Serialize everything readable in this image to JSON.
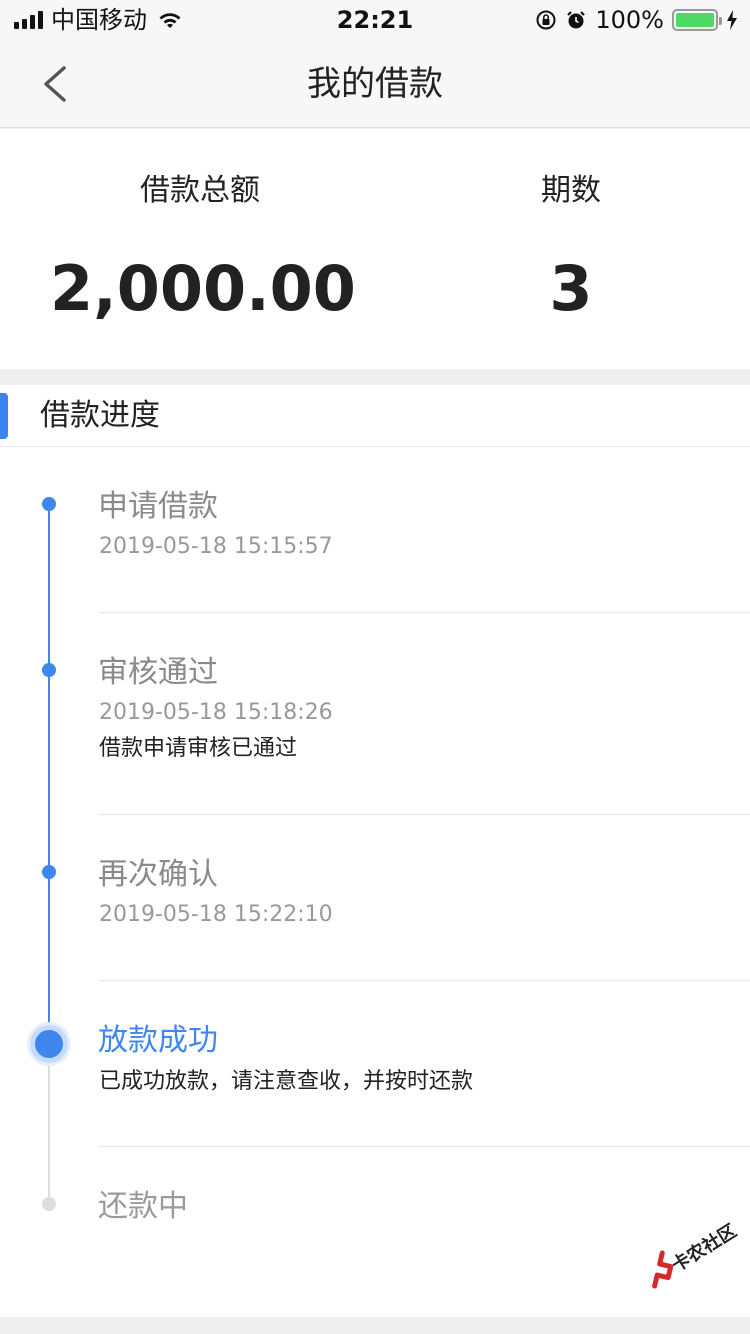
{
  "status_bar": {
    "carrier": "中国移动",
    "time": "22:21",
    "battery": "100%",
    "battery_level": 1.0,
    "battery_color": "#4cd964"
  },
  "nav": {
    "back_icon": "chevron-left-icon",
    "title": "我的借款"
  },
  "summary": {
    "total_label": "借款总额",
    "total_value": "2,000.00",
    "periods_label": "期数",
    "periods_value": "3"
  },
  "progress": {
    "title": "借款进度",
    "accent_color": "#3f86ef",
    "steps": [
      {
        "title": "申请借款",
        "time": "2019-05-18 15:15:57",
        "status": "done"
      },
      {
        "title": "审核通过",
        "time": "2019-05-18 15:18:26",
        "desc": "借款申请审核已通过",
        "status": "done"
      },
      {
        "title": "再次确认",
        "time": "2019-05-18 15:22:10",
        "status": "done"
      },
      {
        "title": "放款成功",
        "desc": "已成功放款，请注意查收，并按时还款",
        "status": "current"
      },
      {
        "title": "还款中",
        "status": "pending"
      }
    ]
  },
  "watermark": {
    "text": "卡农社区"
  }
}
